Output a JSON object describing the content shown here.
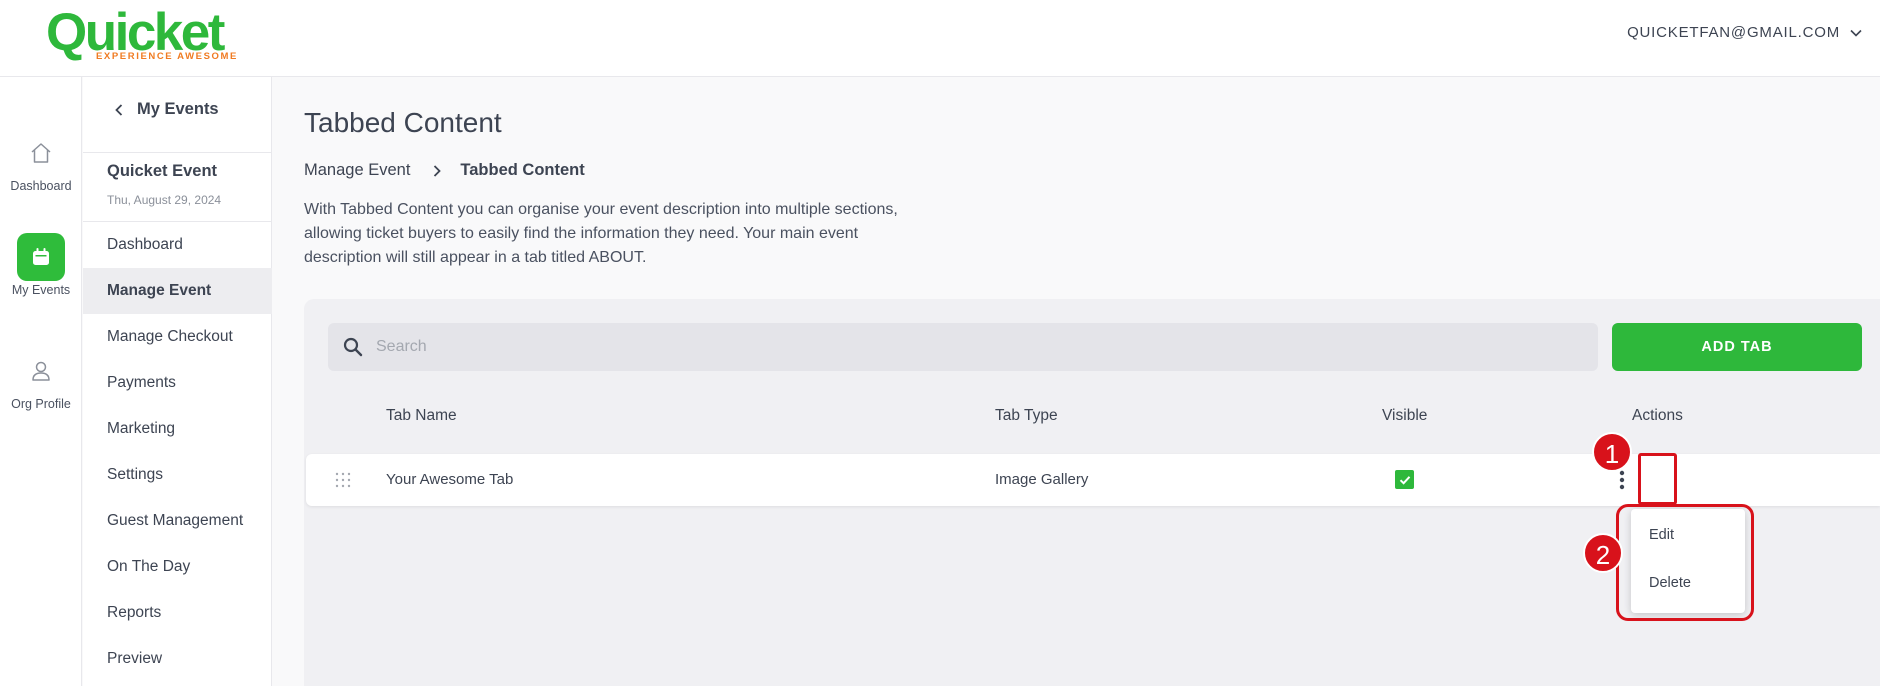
{
  "header": {
    "logo_text": "Quicket",
    "logo_tagline": "EXPERIENCE AWESOME",
    "user_email": "QUICKETFAN@GMAIL.COM"
  },
  "rail": {
    "items": [
      {
        "label": "Dashboard",
        "icon": "home-icon"
      },
      {
        "label": "My Events",
        "icon": "calendar-icon",
        "active": true
      },
      {
        "label": "Org Profile",
        "icon": "user-icon"
      }
    ]
  },
  "sidebar": {
    "back_label": "My Events",
    "event_name": "Quicket Event",
    "event_date": "Thu, August 29, 2024",
    "nav": [
      "Dashboard",
      "Manage Event",
      "Manage Checkout",
      "Payments",
      "Marketing",
      "Settings",
      "Guest Management",
      "On The Day",
      "Reports",
      "Preview"
    ],
    "active_nav": "Manage Event"
  },
  "main": {
    "title": "Tabbed Content",
    "breadcrumb": {
      "parent": "Manage Event",
      "current": "Tabbed Content"
    },
    "description": "With Tabbed Content you can organise your event description into multiple sections, allowing ticket buyers to easily find the information they need. Your main event description will still appear in a tab titled ABOUT.",
    "search_placeholder": "Search",
    "add_button": "ADD TAB",
    "columns": {
      "name": "Tab Name",
      "type": "Tab Type",
      "visible": "Visible",
      "actions": "Actions"
    },
    "rows": [
      {
        "name": "Your Awesome Tab",
        "type": "Image Gallery",
        "visible": true
      }
    ],
    "actions_menu": [
      "Edit",
      "Delete"
    ]
  },
  "annotations": [
    "1",
    "2"
  ],
  "colors": {
    "brand_green": "#2eb83b",
    "accent_orange": "#f07b22",
    "highlight_red": "#d8121b"
  }
}
